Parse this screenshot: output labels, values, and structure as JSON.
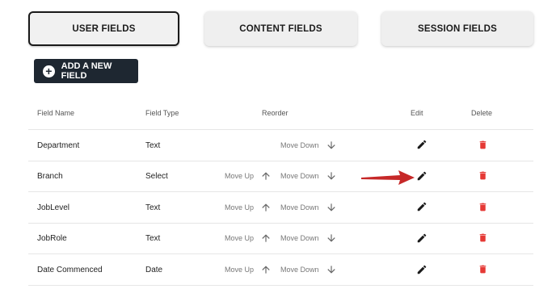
{
  "tabs": [
    {
      "label": "USER FIELDS",
      "active": true
    },
    {
      "label": "CONTENT FIELDS",
      "active": false
    },
    {
      "label": "SESSION FIELDS",
      "active": false
    }
  ],
  "add_button": {
    "label": "ADD A NEW FIELD",
    "icon": "plus-circle-icon"
  },
  "table": {
    "headers": {
      "field_name": "Field Name",
      "field_type": "Field Type",
      "reorder": "Reorder",
      "edit": "Edit",
      "delete": "Delete"
    },
    "rows": [
      {
        "name": "Department",
        "type": "Text",
        "move_up": null,
        "move_down": "Move Down"
      },
      {
        "name": "Branch",
        "type": "Select",
        "move_up": "Move Up",
        "move_down": "Move Down"
      },
      {
        "name": "JobLevel",
        "type": "Text",
        "move_up": "Move Up",
        "move_down": "Move Down"
      },
      {
        "name": "JobRole",
        "type": "Text",
        "move_up": "Move Up",
        "move_down": "Move Down"
      },
      {
        "name": "Date Commenced",
        "type": "Date",
        "move_up": "Move Up",
        "move_down": "Move Down"
      }
    ]
  },
  "colors": {
    "accent_dark": "#1e2731",
    "delete_red": "#e53935",
    "pointer_red": "#c62828"
  },
  "icons": {
    "edit": "pencil-icon",
    "delete": "trash-icon",
    "move_up": "arrow-up-icon",
    "move_down": "arrow-down-icon",
    "annotation": "red-pointer-arrow"
  }
}
